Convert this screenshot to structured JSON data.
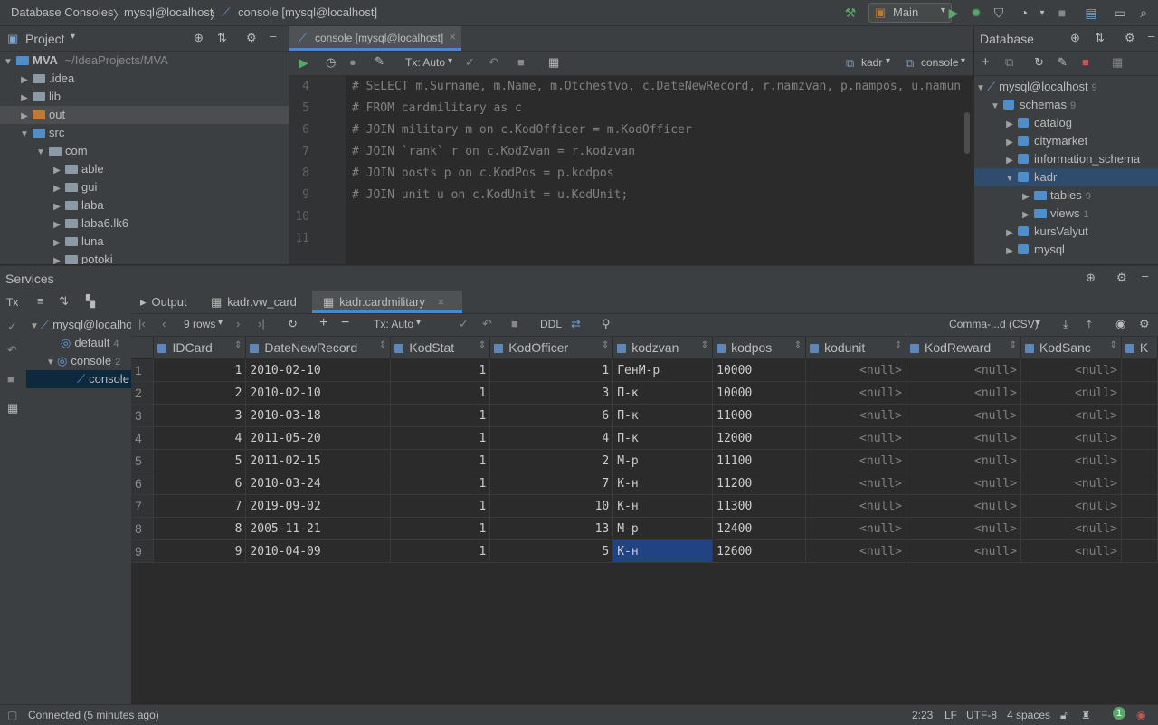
{
  "nav": {
    "crumb1": "Database Consoles",
    "crumb2": "mysql@localhost",
    "crumb3": "console [mysql@localhost]",
    "run_config": "Main"
  },
  "project": {
    "title": "Project",
    "items": [
      {
        "label": "MVA",
        "path": "~/IdeaProjects/MVA"
      },
      {
        "label": ".idea"
      },
      {
        "label": "lib"
      },
      {
        "label": "out"
      },
      {
        "label": "src"
      },
      {
        "label": "com"
      },
      {
        "label": "able"
      },
      {
        "label": "gui"
      },
      {
        "label": "laba"
      },
      {
        "label": "laba6.lk6"
      },
      {
        "label": "luna"
      },
      {
        "label": "potoki"
      }
    ]
  },
  "editor": {
    "tab": "console [mysql@localhost]",
    "tx": "Tx: Auto",
    "schema": "kadr",
    "console": "console",
    "line_numbers": [
      "4",
      "5",
      "6",
      "7",
      "8",
      "9",
      "10",
      "11"
    ],
    "lines": [
      "# SELECT m.Surname, m.Name, m.Otchestvo, c.DateNewRecord, r.namzvan, p.nampos, u.namun",
      "# FROM cardmilitary as c",
      "# JOIN military m on c.KodOfficer = m.KodOfficer",
      "# JOIN `rank` r on c.KodZvan = r.kodzvan",
      "# JOIN posts p on c.KodPos = p.kodpos",
      "# JOIN unit u on c.KodUnit = u.KodUnit;",
      "",
      ""
    ]
  },
  "database": {
    "title": "Database",
    "items": [
      {
        "label": "mysql@localhost",
        "count": "9"
      },
      {
        "label": "schemas",
        "count": "9"
      },
      {
        "label": "catalog",
        "count": ""
      },
      {
        "label": "citymarket",
        "count": ""
      },
      {
        "label": "information_schema",
        "count": ""
      },
      {
        "label": "kadr",
        "count": ""
      },
      {
        "label": "tables",
        "count": "9"
      },
      {
        "label": "views",
        "count": "1"
      },
      {
        "label": "kursValyut",
        "count": ""
      },
      {
        "label": "mysql",
        "count": ""
      }
    ]
  },
  "services": {
    "title": "Services",
    "tx_label": "Tx",
    "tree": [
      {
        "label": "mysql@localhost"
      },
      {
        "label": "default",
        "count": "4"
      },
      {
        "label": "console",
        "count": "2"
      },
      {
        "label": "console"
      }
    ],
    "tabs": [
      "Output",
      "kadr.vw_card",
      "kadr.cardmilitary"
    ],
    "rows_label": "9 rows",
    "tx": "Tx: Auto",
    "ddl": "DDL",
    "export_format": "Comma-...d (CSV)"
  },
  "grid": {
    "columns": [
      "IDCard",
      "DateNewRecord",
      "KodStat",
      "KodOfficer",
      "kodzvan",
      "kodpos",
      "kodunit",
      "KodReward",
      "KodSanc",
      "K"
    ],
    "rows": [
      [
        "1",
        "1",
        "2010-02-10",
        "1",
        "1",
        "ГенМ-р",
        "10000",
        "<null>",
        "<null>",
        "<null>"
      ],
      [
        "2",
        "2",
        "2010-02-10",
        "1",
        "3",
        "П-к",
        "10000",
        "<null>",
        "<null>",
        "<null>"
      ],
      [
        "3",
        "3",
        "2010-03-18",
        "1",
        "6",
        "П-к",
        "11000",
        "<null>",
        "<null>",
        "<null>"
      ],
      [
        "4",
        "4",
        "2011-05-20",
        "1",
        "4",
        "П-к",
        "12000",
        "<null>",
        "<null>",
        "<null>"
      ],
      [
        "5",
        "5",
        "2011-02-15",
        "1",
        "2",
        "М-р",
        "11100",
        "<null>",
        "<null>",
        "<null>"
      ],
      [
        "6",
        "6",
        "2010-03-24",
        "1",
        "7",
        "К-н",
        "11200",
        "<null>",
        "<null>",
        "<null>"
      ],
      [
        "7",
        "7",
        "2019-09-02",
        "1",
        "10",
        "К-н",
        "11300",
        "<null>",
        "<null>",
        "<null>"
      ],
      [
        "8",
        "8",
        "2005-11-21",
        "1",
        "13",
        "М-р",
        "12400",
        "<null>",
        "<null>",
        "<null>"
      ],
      [
        "9",
        "9",
        "2010-04-09",
        "1",
        "5",
        "К-н",
        "12600",
        "<null>",
        "<null>",
        "<null>"
      ]
    ]
  },
  "status": {
    "message": "Connected (5 minutes ago)",
    "position": "2:23",
    "line_sep": "LF",
    "encoding": "UTF-8",
    "indent": "4 spaces"
  },
  "colors": {
    "accent": "#4a88c7",
    "selection": "#214283",
    "run_green": "#59a869"
  }
}
